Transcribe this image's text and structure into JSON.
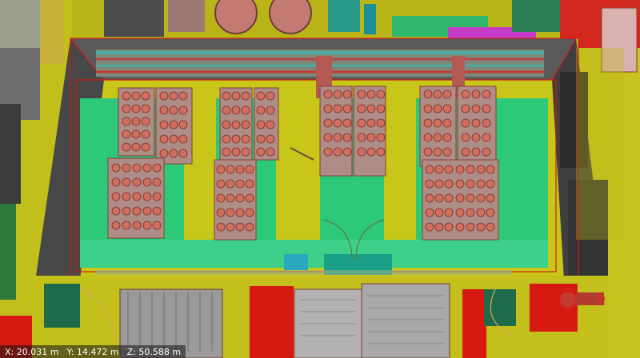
{
  "viewer": {
    "coords": {
      "x": "X: 20.031 m",
      "y": "Y: 14.472 m",
      "z": "Z: 50.588 m"
    }
  },
  "colors": {
    "floor_yellow": "#c8c619",
    "bay_green": "#2ec879",
    "wall_dark": "#474747",
    "red_accent": "#d61a12",
    "cylinder": "#cf6f5f",
    "rack_frame": "#ad8d86",
    "piping_teal": "#3ab3ae",
    "magenta": "#d23ad0"
  }
}
